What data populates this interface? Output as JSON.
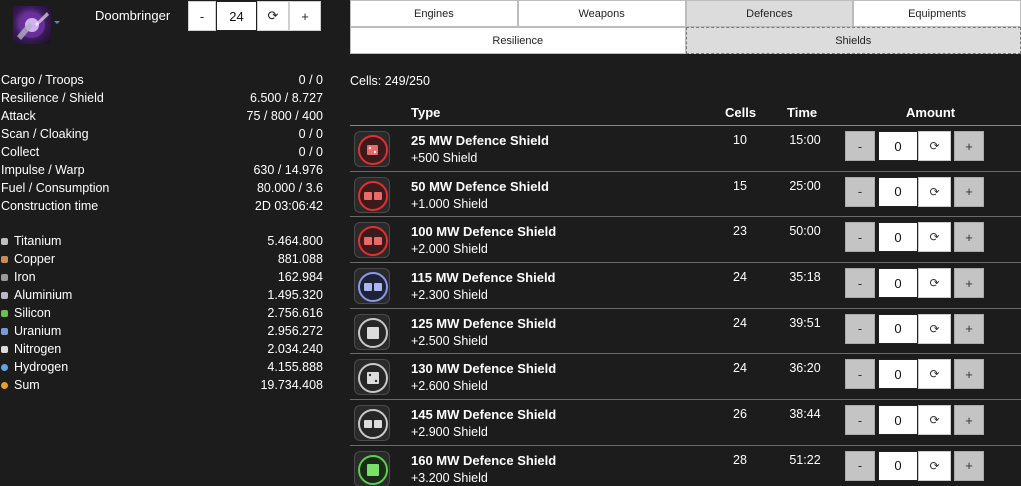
{
  "ship": {
    "name": "Doombringer",
    "count": "24",
    "minus_label": "-",
    "plus_label": "+",
    "reset_label": "⟳"
  },
  "stats": [
    {
      "label": "Cargo / Troops",
      "value": "0 / 0"
    },
    {
      "label": "Resilience / Shield",
      "value": "6.500 / 8.727"
    },
    {
      "label": "Attack",
      "value": "75 / 800 / 400"
    },
    {
      "label": "Scan / Cloaking",
      "value": "0 / 0"
    },
    {
      "label": "Collect",
      "value": "0 / 0"
    },
    {
      "label": "Impulse / Warp",
      "value": "630 / 14.976"
    },
    {
      "label": "Fuel / Consumption",
      "value": "80.000 / 3.6"
    },
    {
      "label": "Construction time",
      "value": "2D 03:06:42"
    }
  ],
  "resources": [
    {
      "label": "Titanium",
      "value": "5.464.800",
      "color": "#bfbfbf",
      "icon": "titanium-icon"
    },
    {
      "label": "Copper",
      "value": "881.088",
      "color": "#c98a5a",
      "icon": "copper-icon"
    },
    {
      "label": "Iron",
      "value": "162.984",
      "color": "#9a9a9a",
      "icon": "iron-icon"
    },
    {
      "label": "Aluminium",
      "value": "1.495.320",
      "color": "#b8b8c8",
      "icon": "aluminium-icon"
    },
    {
      "label": "Silicon",
      "value": "2.756.616",
      "color": "#6cc04a",
      "icon": "silicon-icon"
    },
    {
      "label": "Uranium",
      "value": "2.956.272",
      "color": "#7a9ad8",
      "icon": "uranium-icon"
    },
    {
      "label": "Nitrogen",
      "value": "2.034.240",
      "color": "#dcdcdc",
      "icon": "nitrogen-icon"
    },
    {
      "label": "Hydrogen",
      "value": "4.155.888",
      "color": "#5aa8e8",
      "icon": "hydrogen-icon"
    },
    {
      "label": "Sum",
      "value": "19.734.408",
      "color": "#e8a020",
      "icon": "sum-icon"
    }
  ],
  "tabs": {
    "row1": [
      "Engines",
      "Weapons",
      "Defences",
      "Equipments"
    ],
    "row1_active": 2,
    "row2": [
      "Resilience",
      "Shields"
    ],
    "row2_active": 1
  },
  "cells_info": "Cells: 249/250",
  "table": {
    "headers": {
      "type": "Type",
      "cells": "Cells",
      "time": "Time",
      "amount": "Amount"
    },
    "rows": [
      {
        "name": "25 MW Defence Shield",
        "bonus": "+500 Shield",
        "cells": "10",
        "time": "15:00",
        "amount": "0",
        "icon_color": "#e03030",
        "icon": "red-shield-icon"
      },
      {
        "name": "50 MW Defence Shield",
        "bonus": "+1.000 Shield",
        "cells": "15",
        "time": "25:00",
        "amount": "0",
        "icon_color": "#e03030",
        "icon": "red-shield-icon"
      },
      {
        "name": "100 MW Defence Shield",
        "bonus": "+2.000 Shield",
        "cells": "23",
        "time": "50:00",
        "amount": "0",
        "icon_color": "#e03030",
        "icon": "red-shield-icon"
      },
      {
        "name": "115 MW Defence Shield",
        "bonus": "+2.300 Shield",
        "cells": "24",
        "time": "35:18",
        "amount": "0",
        "icon_color": "#8a9ae8",
        "icon": "blue-shield-icon"
      },
      {
        "name": "125 MW Defence Shield",
        "bonus": "+2.500 Shield",
        "cells": "24",
        "time": "39:51",
        "amount": "0",
        "icon_color": "#c8c8c8",
        "icon": "white-shield-icon"
      },
      {
        "name": "130 MW Defence Shield",
        "bonus": "+2.600 Shield",
        "cells": "24",
        "time": "36:20",
        "amount": "0",
        "icon_color": "#c8c8c8",
        "icon": "white-shield-icon"
      },
      {
        "name": "145 MW Defence Shield",
        "bonus": "+2.900 Shield",
        "cells": "26",
        "time": "38:44",
        "amount": "0",
        "icon_color": "#c8c8c8",
        "icon": "white-shield-icon"
      },
      {
        "name": "160 MW Defence Shield",
        "bonus": "+3.200 Shield",
        "cells": "28",
        "time": "51:22",
        "amount": "0",
        "icon_color": "#5ad04a",
        "icon": "green-shield-icon"
      }
    ]
  },
  "amount_controls": {
    "minus": "-",
    "plus": "+",
    "reset": "⟳"
  }
}
